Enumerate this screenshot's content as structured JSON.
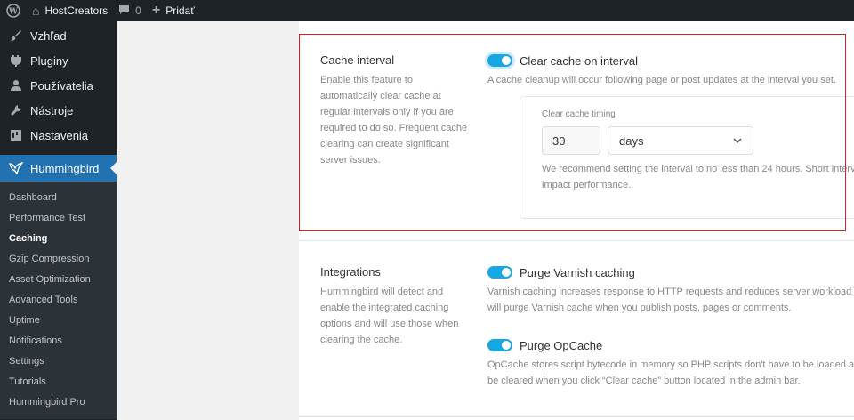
{
  "adminbar": {
    "site_name": "HostCreators",
    "comments_count": "0",
    "add_label": "Pridať"
  },
  "sidebar": {
    "menu": [
      {
        "label": "Vzhľad",
        "icon": "paintbrush-icon"
      },
      {
        "label": "Pluginy",
        "icon": "plugin-icon"
      },
      {
        "label": "Používatelia",
        "icon": "users-icon"
      },
      {
        "label": "Nástroje",
        "icon": "wrench-icon"
      },
      {
        "label": "Nastavenia",
        "icon": "settings-icon"
      }
    ],
    "current": {
      "label": "Hummingbird",
      "icon": "hummingbird-icon"
    },
    "submenu": [
      "Dashboard",
      "Performance Test",
      "Caching",
      "Gzip Compression",
      "Asset Optimization",
      "Advanced Tools",
      "Uptime",
      "Notifications",
      "Settings",
      "Tutorials",
      "Hummingbird Pro"
    ],
    "active_submenu": "Caching"
  },
  "cache_interval": {
    "title": "Cache interval",
    "description": "Enable this feature to automatically clear cache at regular intervals only if you are required to do so. Frequent cache clearing can create significant server issues.",
    "toggle_label": "Clear cache on interval",
    "toggle_on": true,
    "toggle_description": "A cache cleanup will occur following page or post updates at the interval you set.",
    "timing": {
      "label": "Clear cache timing",
      "value": "30",
      "unit": "days",
      "note_line1": "We recommend setting the interval to no less than 24 hours. Short intervals and",
      "note_line2": "impact performance."
    }
  },
  "integrations": {
    "title": "Integrations",
    "description": "Hummingbird will detect and enable the integrated caching options and will use those when clearing the cache.",
    "varnish": {
      "label": "Purge Varnish caching",
      "on": true,
      "desc_line1": "Varnish caching increases response to HTTP requests and reduces server workload",
      "desc_line2": "will purge Varnish cache when you publish posts, pages or comments."
    },
    "opcache": {
      "label": "Purge OpCache",
      "on": true,
      "desc_line1": "OpCache stores script bytecode in memory so PHP scripts don't have to be loaded a",
      "desc_line2": "be cleared when you click “Clear cache” button located in the admin bar."
    }
  },
  "colors": {
    "toggle_on": "#17a8e3",
    "highlight": "#e01b1b",
    "admin_bg": "#1d2327",
    "current_menu": "#2271b1"
  }
}
